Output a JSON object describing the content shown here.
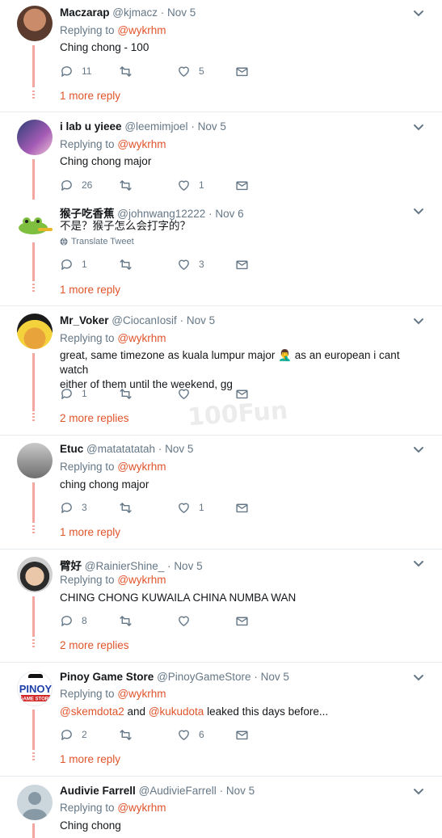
{
  "watermark": "100Fun",
  "tweets": [
    {
      "name": "Maczarap",
      "handle": "@kjmacz",
      "date": "Nov 5",
      "replying_label": "Replying to",
      "replying_to": "@wykrhm",
      "text": "Ching chong - 100",
      "replies": "11",
      "retweets": "",
      "likes": "5",
      "more_replies": "1 more reply",
      "avatar_icon": "person-photo"
    },
    {
      "name": "i lab u yieee",
      "handle": "@leemimjoel",
      "date": "Nov 5",
      "replying_label": "Replying to",
      "replying_to": "@wykrhm",
      "text": "Ching chong major",
      "replies": "26",
      "retweets": "",
      "likes": "1",
      "avatar_icon": "anime-photo"
    },
    {
      "name": "猴子吃香蕉",
      "handle": "@johnwang12222",
      "date": "Nov 6",
      "text": "不是？猴子怎么会打字的？",
      "translate": "Translate Tweet",
      "replies": "1",
      "retweets": "",
      "likes": "3",
      "more_replies": "1 more reply",
      "avatar_icon": "frog-avatar"
    },
    {
      "name": "Mr_Voker",
      "handle": "@CiocanIosif",
      "date": "Nov 5",
      "replying_label": "Replying to",
      "replying_to": "@wykrhm",
      "text1": "great, same timezone as kuala lumpur major",
      "emoji": "🤦‍♂️",
      "text2": "as an european i cant watch",
      "text3": "either of them until the weekend, gg",
      "replies": "1",
      "retweets": "",
      "likes": "",
      "more_replies": "2 more replies",
      "avatar_icon": "goku-avatar"
    },
    {
      "name": "Etuc",
      "handle": "@matatatatah",
      "date": "Nov 5",
      "replying_label": "Replying to",
      "replying_to": "@wykrhm",
      "text": "ching chong major",
      "replies": "3",
      "retweets": "",
      "likes": "1",
      "more_replies": "1 more reply",
      "avatar_icon": "shadow-figure"
    },
    {
      "name": "臂好",
      "handle": "@RainierShine_",
      "date": "Nov 5",
      "replying_label": "Replying to",
      "replying_to": "@wykrhm",
      "text": "CHING CHONG KUWAILA CHINA NUMBA WAN",
      "replies": "8",
      "retweets": "",
      "likes": "",
      "more_replies": "2 more replies",
      "avatar_icon": "person-photo"
    },
    {
      "name": "Pinoy Game Store",
      "handle": "@PinoyGameStore",
      "date": "Nov 5",
      "replying_label": "Replying to",
      "replying_to": "@wykrhm",
      "mention1": "@skemdota2",
      "and": "and",
      "mention2": "@kukudota",
      "text_tail": "leaked this days before...",
      "replies": "2",
      "retweets": "",
      "likes": "6",
      "more_replies": "1 more reply",
      "avatar_icon": "pinoy-logo",
      "logo_text_top": "PINOY",
      "logo_text_bottom": "GAME STORE"
    },
    {
      "name": "Audivie Farrell",
      "handle": "@AudivieFarrell",
      "date": "Nov 5",
      "replying_label": "Replying to",
      "replying_to": "@wykrhm",
      "text": "Ching chong",
      "avatar_icon": "default-avatar"
    }
  ],
  "colors": {
    "accent": "#e0542b",
    "thread": "#f4a7a0",
    "muted": "#657786",
    "separator": "#e6ecf0"
  }
}
